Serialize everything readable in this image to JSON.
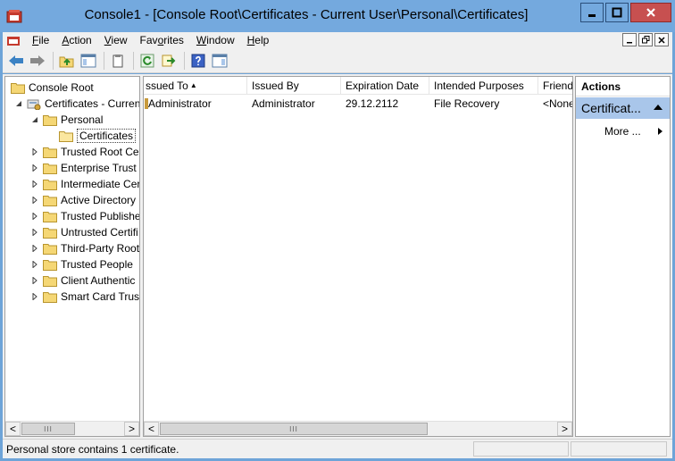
{
  "window": {
    "title": "Console1 - [Console Root\\Certificates - Current User\\Personal\\Certificates]"
  },
  "menu": {
    "items": [
      {
        "label": "File",
        "accel": "F",
        "rest": "ile"
      },
      {
        "label": "Action",
        "accel": "A",
        "rest": "ction"
      },
      {
        "label": "View",
        "accel": "V",
        "rest": "iew"
      },
      {
        "label": "Favorites",
        "pre": "Fav",
        "accel": "o",
        "rest": "rites"
      },
      {
        "label": "Window",
        "accel": "W",
        "rest": "indow"
      },
      {
        "label": "Help",
        "accel": "H",
        "rest": "elp"
      }
    ]
  },
  "tree": {
    "root": "Console Root",
    "snapin": "Certificates - Curren",
    "personal": "Personal",
    "certificates": "Certificates",
    "stores": [
      "Trusted Root Ce",
      "Enterprise Trust",
      "Intermediate Cer",
      "Active Directory",
      "Trusted Publishe",
      "Untrusted Certifi",
      "Third-Party Root",
      "Trusted People",
      "Client Authentic",
      "Smart Card Trus"
    ]
  },
  "list": {
    "columns": [
      "ssued To",
      "Issued By",
      "Expiration Date",
      "Intended Purposes",
      "Friend"
    ],
    "rows": [
      [
        "Administrator",
        "Administrator",
        "29.12.2112",
        "File Recovery",
        "<None"
      ]
    ]
  },
  "actions": {
    "title": "Actions",
    "group": "Certificat...",
    "more": "More ..."
  },
  "status": {
    "text": "Personal store contains 1 certificate."
  },
  "scroll": {
    "left_glyph": "<",
    "right_glyph": ">",
    "grip": "III"
  },
  "colors": {
    "title_bar": "#74a9de",
    "close_button": "#c75050",
    "actions_header": "#a9c6ea",
    "folder": "#f5d775"
  }
}
